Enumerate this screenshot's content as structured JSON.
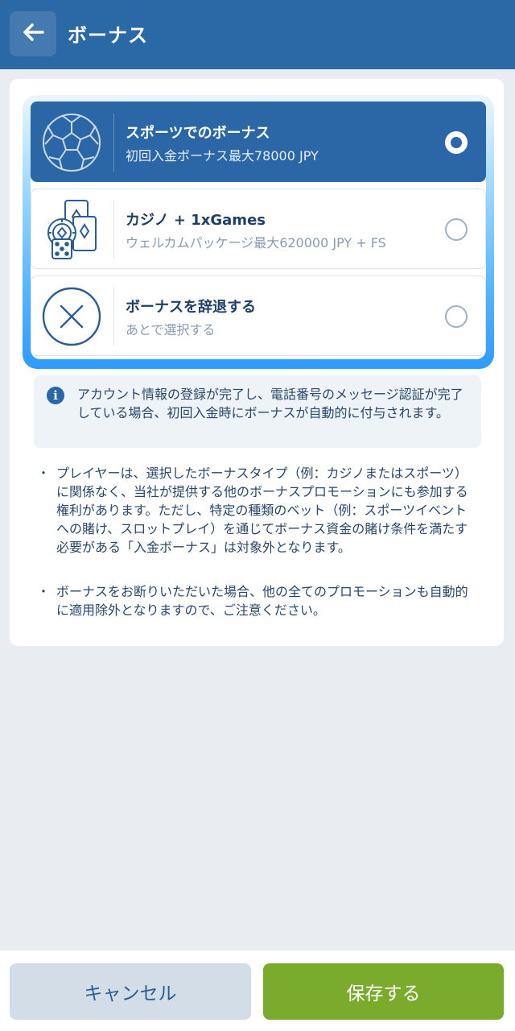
{
  "header": {
    "title": "ボーナス",
    "back_icon": "arrow-left-icon"
  },
  "options": [
    {
      "title": "スポーツでのボーナス",
      "subtitle": "初回入金ボーナス最大78000 JPY",
      "icon": "soccer-ball-icon",
      "selected": true
    },
    {
      "title": "カジノ + 1xGames",
      "subtitle": "ウェルカムパッケージ最大620000 JPY + FS",
      "icon": "casino-cards-icon",
      "selected": false
    },
    {
      "title": "ボーナスを辞退する",
      "subtitle": "あとで選択する",
      "icon": "close-circle-icon",
      "selected": false
    }
  ],
  "info": {
    "icon": "info-icon",
    "text": "アカウント情報の登録が完了し、電話番号のメッセージ認証が完了している場合、初回入金時にボーナスが自動的に付与されます。"
  },
  "bullets": [
    "プレイヤーは、選択したボーナスタイプ（例：カジノまたはスポーツ）に関係なく、当社が提供する他のボーナスプロモーションにも参加する権利があります。ただし、特定の種類のベット（例：スポーツイベントへの賭け、スロットプレイ）を通じてボーナス資金の賭け条件を満たす必要がある「入金ボーナス」は対象外となります。",
    "ボーナスをお断りいただいた場合、他の全てのプロモーションも自動的に適用除外となりますので、ご注意ください。"
  ],
  "footer": {
    "cancel_label": "キャンセル",
    "save_label": "保存する"
  },
  "colors": {
    "header": "#2b68a6",
    "selected": "#2b66a6",
    "save": "#7aab2c",
    "cancel": "#d3dde7"
  }
}
